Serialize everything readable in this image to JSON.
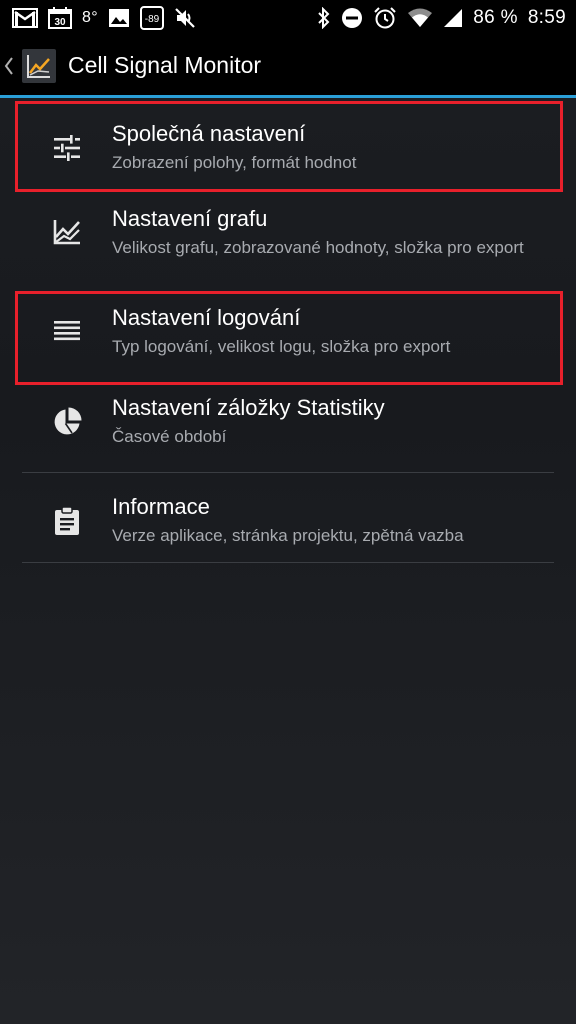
{
  "status_bar": {
    "calendar_day": "30",
    "temperature": "8°",
    "signal_badge": "-89",
    "battery": "86 %",
    "time": "8:59"
  },
  "app_bar": {
    "title": "Cell Signal Monitor"
  },
  "settings": [
    {
      "title": "Společná nastavení",
      "summary": "Zobrazení polohy, formát hodnot",
      "icon": "tune-sliders-icon",
      "highlighted": true
    },
    {
      "title": "Nastavení grafu",
      "summary": "Velikost grafu, zobrazované hodnoty, složka pro export",
      "icon": "line-chart-icon",
      "highlighted": false
    },
    {
      "title": "Nastavení logování",
      "summary": "Typ logování, velikost logu, složka pro export",
      "icon": "list-lines-icon",
      "highlighted": true
    },
    {
      "title": "Nastavení záložky Statistiky",
      "summary": "Časové období",
      "icon": "pie-chart-icon",
      "highlighted": false
    },
    {
      "title": "Informace",
      "summary": "Verze aplikace, stránka projektu, zpětná vazba",
      "icon": "clipboard-icon",
      "highlighted": false
    }
  ],
  "colors": {
    "accent": "#2a9fd8",
    "highlight_border": "#e8202b",
    "summary_text": "#a8abb0"
  }
}
